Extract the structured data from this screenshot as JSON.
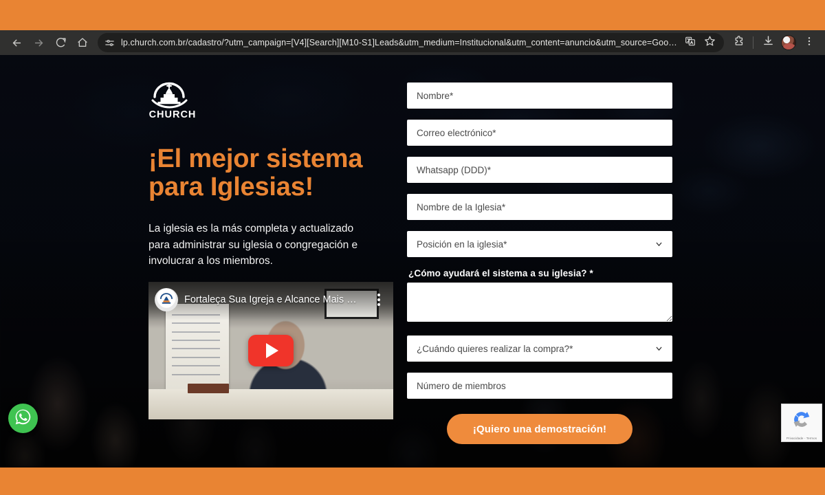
{
  "browser": {
    "back_icon": "back-arrow-icon",
    "forward_icon": "forward-arrow-icon",
    "reload_icon": "reload-icon",
    "home_icon": "home-icon",
    "site_info_icon": "site-info-tune-icon",
    "url": "lp.church.com.br/cadastro/?utm_campaign=[V4][Search][M10-S1]Leads&utm_medium=Institucional&utm_content=anuncio&utm_source=Google&ga...",
    "translate_icon": "translate-icon",
    "bookmark_icon": "star-bookmark-icon",
    "extensions_icon": "extensions-puzzle-icon",
    "downloads_icon": "downloads-icon",
    "profile_icon": "profile-avatar-icon",
    "menu_icon": "three-dot-menu-icon"
  },
  "hero": {
    "logo_text": "CHURCH",
    "headline_line1": "¡El mejor  sistema",
    "headline_line2": "para  Iglesias!",
    "subtext": "La iglesia es la más  completa y actualizado para  administrar  su iglesia o congregación e involucrar a los miembros.",
    "accent_color": "#e98433"
  },
  "video": {
    "title": "Fortaleça Sua Igreja e Alcance Mais …",
    "channel_icon": "youtube-channel-avatar-icon",
    "play_icon": "youtube-play-icon",
    "more_icon": "kebab-menu-icon"
  },
  "form": {
    "name_placeholder": "Nombre*",
    "email_placeholder": "Correo electrónico*",
    "whatsapp_placeholder": "Whatsapp (DDD)*",
    "church_name_placeholder": "Nombre de la Iglesia*",
    "position_selected": "Posición en la iglesia*",
    "help_label": "¿Cómo ayudará el sistema a su iglesia? *",
    "help_value": "",
    "purchase_selected": "¿Cuándo quieres realizar la compra?*",
    "members_placeholder": "Número de miembros",
    "submit_label": "¡Quiero una demostración!",
    "submit_color": "#ef8b3c"
  },
  "floats": {
    "whatsapp_icon": "whatsapp-icon",
    "recaptcha_icon": "recaptcha-logo-icon",
    "recaptcha_text": "Privacidade - Termos"
  }
}
